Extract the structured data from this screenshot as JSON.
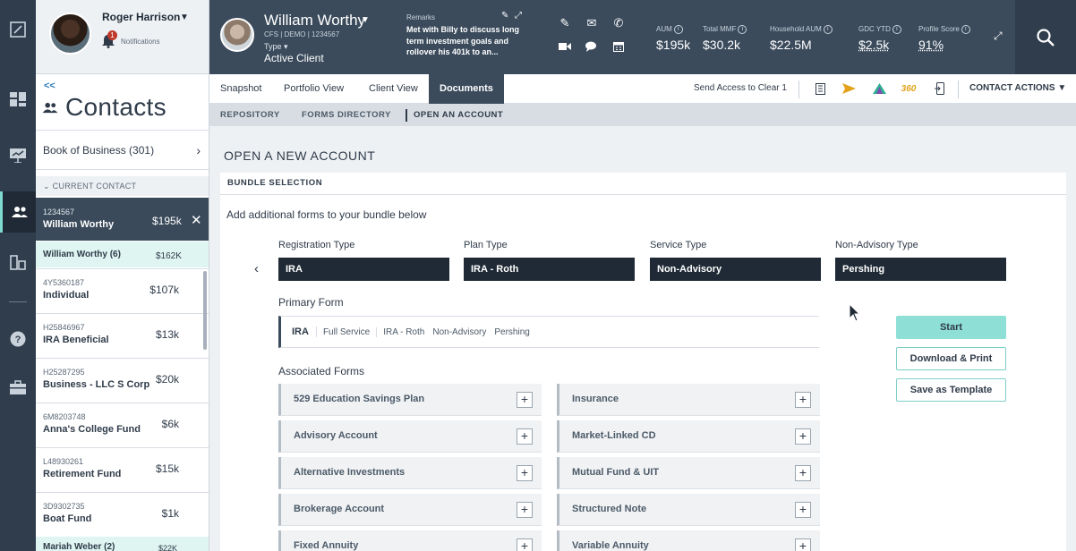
{
  "user": {
    "name": "Roger Harrison",
    "notifications_label": "Notifications",
    "notification_count": "1"
  },
  "rail": {
    "items": [
      "app-logo-icon",
      "dashboard-icon",
      "presentation-icon",
      "contacts-icon",
      "reports-icon",
      "help-icon",
      "briefcase-icon"
    ]
  },
  "contacts": {
    "back_label": "<<",
    "title": "Contacts",
    "book_of_business": "Book of Business (301)",
    "current_contact_header": "CURRENT CONTACT",
    "current": {
      "number": "1234567",
      "name": "William Worthy",
      "value": "$195k"
    },
    "household": {
      "name": "William Worthy (6)",
      "value": "$162K"
    },
    "accounts": [
      {
        "number": "4Y5360187",
        "name": "Individual",
        "value": "$107k"
      },
      {
        "number": "H25846967",
        "name": "IRA Beneficial",
        "value": "$13k"
      },
      {
        "number": "H25287295",
        "name": "Business - LLC S Corp",
        "value": "$20k"
      },
      {
        "number": "6M8203748",
        "name": "Anna's College Fund",
        "value": "$6k"
      },
      {
        "number": "L48930261",
        "name": "Retirement Fund",
        "value": "$15k"
      },
      {
        "number": "3D9302735",
        "name": "Boat Fund",
        "value": "$1k"
      }
    ],
    "next_household": {
      "name": "Mariah Weber (2)",
      "value": "$22K"
    }
  },
  "client": {
    "name": "William Worthy",
    "meta": "CFS | DEMO | 1234567",
    "type_label": "Type",
    "status": "Active Client",
    "remarks_label": "Remarks",
    "remarks_text": "Met with Billy to discuss long term investment goals and rollover his 401k to an..."
  },
  "metrics": [
    {
      "label": "AUM",
      "value": "$195k"
    },
    {
      "label": "Total MMF",
      "value": "$30.2k"
    },
    {
      "label": "Household AUM",
      "value": "$22.5M"
    },
    {
      "label": "GDC YTD",
      "value": "$2.5k"
    },
    {
      "label": "Profile Score",
      "value": "91%"
    }
  ],
  "tabs": [
    {
      "label": "Snapshot"
    },
    {
      "label": "Portfolio View"
    },
    {
      "label": "Client View"
    },
    {
      "label": "Documents",
      "active": true
    }
  ],
  "send_access": "Send Access to Clear 1",
  "contact_actions": "CONTACT ACTIONS",
  "subtabs": [
    {
      "label": "REPOSITORY"
    },
    {
      "label": "FORMS DIRECTORY"
    },
    {
      "label": "OPEN AN ACCOUNT",
      "active": true
    }
  ],
  "page": {
    "title": "OPEN A NEW ACCOUNT",
    "bundle_header": "BUNDLE SELECTION",
    "add_text": "Add additional forms to your bundle below",
    "selectors": [
      {
        "label": "Registration Type",
        "value": "IRA"
      },
      {
        "label": "Plan Type",
        "value": "IRA - Roth"
      },
      {
        "label": "Service Type",
        "value": "Non-Advisory"
      },
      {
        "label": "Non-Advisory Type",
        "value": "Pershing"
      }
    ],
    "primary_form_label": "Primary Form",
    "primary_form": {
      "main": "IRA",
      "items": [
        "Full Service",
        "IRA - Roth",
        "Non-Advisory",
        "Pershing"
      ]
    },
    "associated_label": "Associated Forms",
    "associated_left": [
      "529 Education Savings Plan",
      "Advisory Account",
      "Alternative Investments",
      "Brokerage Account",
      "Fixed Annuity"
    ],
    "associated_right": [
      "Insurance",
      "Market-Linked CD",
      "Mutual Fund & UIT",
      "Structured Note",
      "Variable Annuity"
    ],
    "buttons": {
      "start": "Start",
      "download": "Download & Print",
      "template": "Save as Template"
    }
  },
  "colors": {
    "header": "#3b4b5c",
    "rail": "#2f3d4c",
    "accent": "#8ee0d6",
    "selector": "#1f2a36"
  }
}
